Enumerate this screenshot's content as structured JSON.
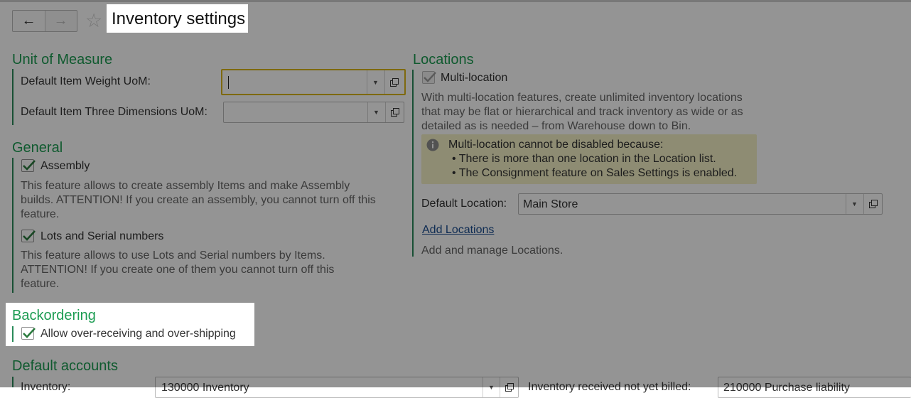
{
  "window": {
    "title": "Inventory settings"
  },
  "nav": {
    "back_icon": "arrow-left-icon",
    "forward_icon": "arrow-right-icon",
    "favorite_icon": "star-icon"
  },
  "unit_of_measure": {
    "heading": "Unit of Measure",
    "weight_label": "Default Item Weight UoM:",
    "weight_value": "",
    "dimensions_label": "Default Item Three Dimensions UoM:",
    "dimensions_value": ""
  },
  "general": {
    "heading": "General",
    "assembly": {
      "label": "Assembly",
      "checked": true,
      "description": "This feature allows to create assembly Items and make Assembly builds. ATTENTION! If you create an assembly, you cannot turn off this feature."
    },
    "lots": {
      "label": "Lots and Serial numbers",
      "checked": true,
      "description": "This feature allows to use Lots and Serial numbers by Items. ATTENTION! If you create one of them you cannot turn off this feature."
    }
  },
  "backordering": {
    "heading": "Backordering",
    "over_receiving": {
      "label": "Allow over-receiving and over-shipping",
      "checked": true
    }
  },
  "default_accounts": {
    "heading": "Default accounts",
    "inventory_label": "Inventory:",
    "inventory_value": "130000 Inventory",
    "received_label": "Inventory received not yet billed:",
    "received_value": "210000 Purchase liability"
  },
  "locations": {
    "heading": "Locations",
    "multi_location": {
      "label": "Multi-location",
      "checked": true,
      "description": "With multi-location features, create unlimited inventory locations that may be flat or hierarchical and track inventory as wide or as detailed as is needed – from Warehouse down to Bin."
    },
    "warning": {
      "title": "Multi-location cannot be disabled because:",
      "reasons": [
        "• There is more than one location in the Location list.",
        "• The Consignment feature on Sales Settings is enabled."
      ]
    },
    "default_location_label": "Default Location:",
    "default_location_value": "Main Store",
    "add_link": "Add Locations",
    "add_hint": "Add and manage Locations."
  },
  "colors": {
    "heading": "#1c9c52",
    "focus_border": "#d9b619",
    "info_bg": "#f4f2c7",
    "link": "#1a4d8f"
  }
}
